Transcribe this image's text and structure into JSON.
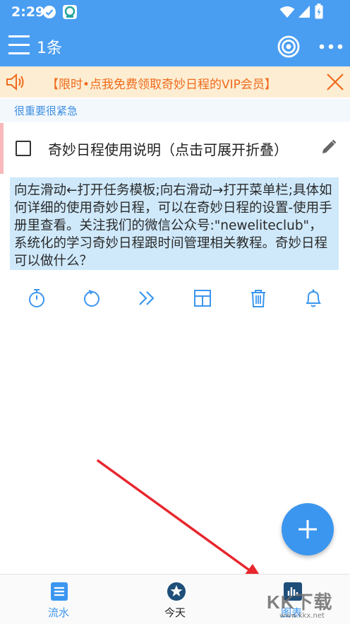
{
  "status_bar": {
    "time": "2:29"
  },
  "app_bar": {
    "count_label": "1条"
  },
  "banner": {
    "text": "【限时•点我免费领取奇妙日程的VIP会员】"
  },
  "section": {
    "label": "很重要很紧急"
  },
  "task": {
    "title": "奇妙日程使用说明（点击可展开折叠）",
    "description": "向左滑动←打开任务模板;向右滑动→打开菜单栏;具体如何详细的使用奇妙日程，可以在奇妙日程的设置-使用手册里查看。关注我们的微信公众号:\"neweliteclub\"，系统化的学习奇妙日程跟时间管理相关教程。奇妙日程可以做什么？"
  },
  "bottom_nav": {
    "items": [
      {
        "label": "流水",
        "icon": "list-icon"
      },
      {
        "label": "今天",
        "icon": "star-icon"
      },
      {
        "label": "图表",
        "icon": "chart-icon"
      }
    ]
  },
  "watermark": {
    "big": "KK下载",
    "small": "www.kkx.net"
  },
  "colors": {
    "primary": "#4a9ef2",
    "banner_bg": "#fdeed3",
    "banner_text": "#f06a1b",
    "section_text": "#3d8fe3",
    "desc_bg": "#cfe9fb",
    "fab": "#3b96ef",
    "arrow": "#e8262d"
  }
}
